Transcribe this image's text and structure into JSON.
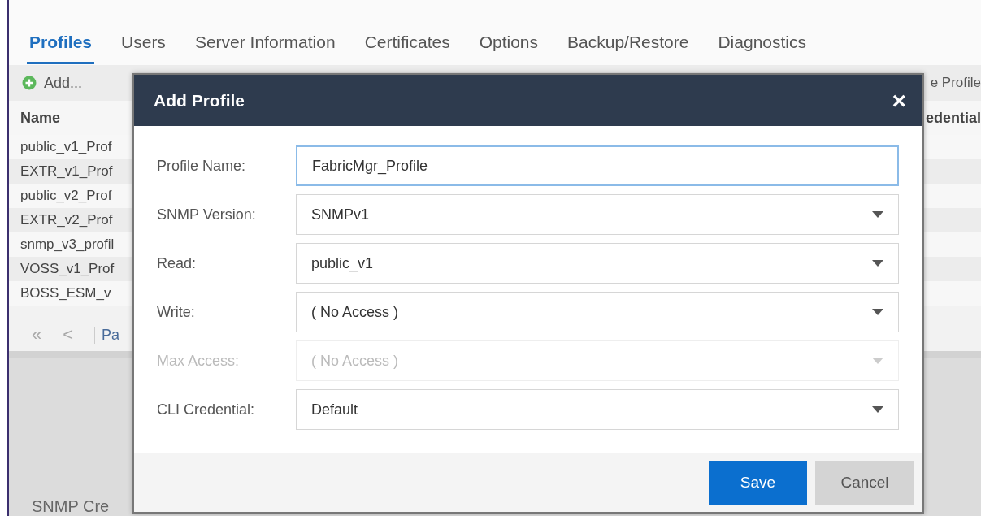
{
  "tabs": [
    {
      "label": "Profiles",
      "selected": true
    },
    {
      "label": "Users",
      "selected": false
    },
    {
      "label": "Server Information",
      "selected": false
    },
    {
      "label": "Certificates",
      "selected": false
    },
    {
      "label": "Options",
      "selected": false
    },
    {
      "label": "Backup/Restore",
      "selected": false
    },
    {
      "label": "Diagnostics",
      "selected": false
    }
  ],
  "toolbar": {
    "add_label": "Add...",
    "right_label": "e Profile"
  },
  "table": {
    "columns": [
      "Name",
      "edential"
    ],
    "rows": [
      "public_v1_Prof",
      "EXTR_v1_Prof",
      "public_v2_Prof",
      "EXTR_v2_Prof",
      "snmp_v3_profil",
      "VOSS_v1_Prof",
      "BOSS_ESM_v"
    ]
  },
  "pager": {
    "first": "«",
    "prev": "<",
    "page_label": "Pa"
  },
  "bottom_tabs": [
    {
      "label": "SNMP Cre",
      "selected": false
    }
  ],
  "dialog": {
    "title": "Add Profile",
    "close": "×",
    "fields": [
      {
        "kind": "text",
        "label": "Profile Name:",
        "value": "FabricMgr_Profile",
        "disabled": false,
        "focused": true
      },
      {
        "kind": "select",
        "label": "SNMP Version:",
        "value": "SNMPv1",
        "disabled": false,
        "focused": false
      },
      {
        "kind": "select",
        "label": "Read:",
        "value": "public_v1",
        "disabled": false,
        "focused": false
      },
      {
        "kind": "select",
        "label": "Write:",
        "value": "( No Access )",
        "disabled": false,
        "focused": false
      },
      {
        "kind": "select",
        "label": "Max Access:",
        "value": "( No Access )",
        "disabled": true,
        "focused": false
      },
      {
        "kind": "select",
        "label": "CLI Credential:",
        "value": "Default",
        "disabled": false,
        "focused": false
      }
    ],
    "buttons": [
      {
        "label": "Save",
        "kind": "primary"
      },
      {
        "label": "Cancel",
        "kind": "secondary"
      }
    ]
  }
}
